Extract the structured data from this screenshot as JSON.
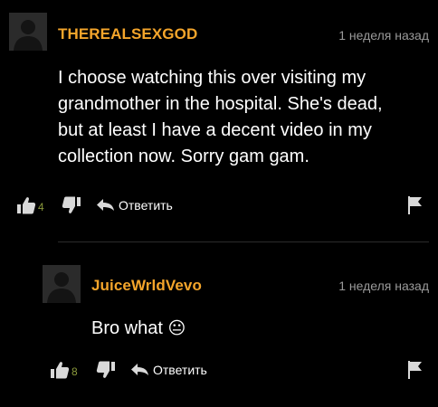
{
  "comments": [
    {
      "username": "THEREALSEXGOD",
      "timestamp": "1 неделя назад",
      "text": "I choose watching this over visiting my grandmother in the hospital. She's dead, but at least I have a decent video in my collection now. Sorry gam gam.",
      "likes": "4",
      "reply_label": "Ответить"
    },
    {
      "username": "JuiceWrldVevo",
      "timestamp": "1 неделя назад",
      "text": "Bro what",
      "emoji": "😐",
      "likes": "8",
      "reply_label": "Ответить"
    }
  ],
  "colors": {
    "background": "#000000",
    "username": "#f4a52b",
    "timestamp": "#9a9a9a",
    "like_count": "#8b9a3c",
    "icon": "#d9d9d9"
  },
  "icons": [
    "avatar-placeholder",
    "thumbs-up-icon",
    "thumbs-down-icon",
    "reply-arrow-icon",
    "flag-icon",
    "neutral-face-emoji"
  ]
}
